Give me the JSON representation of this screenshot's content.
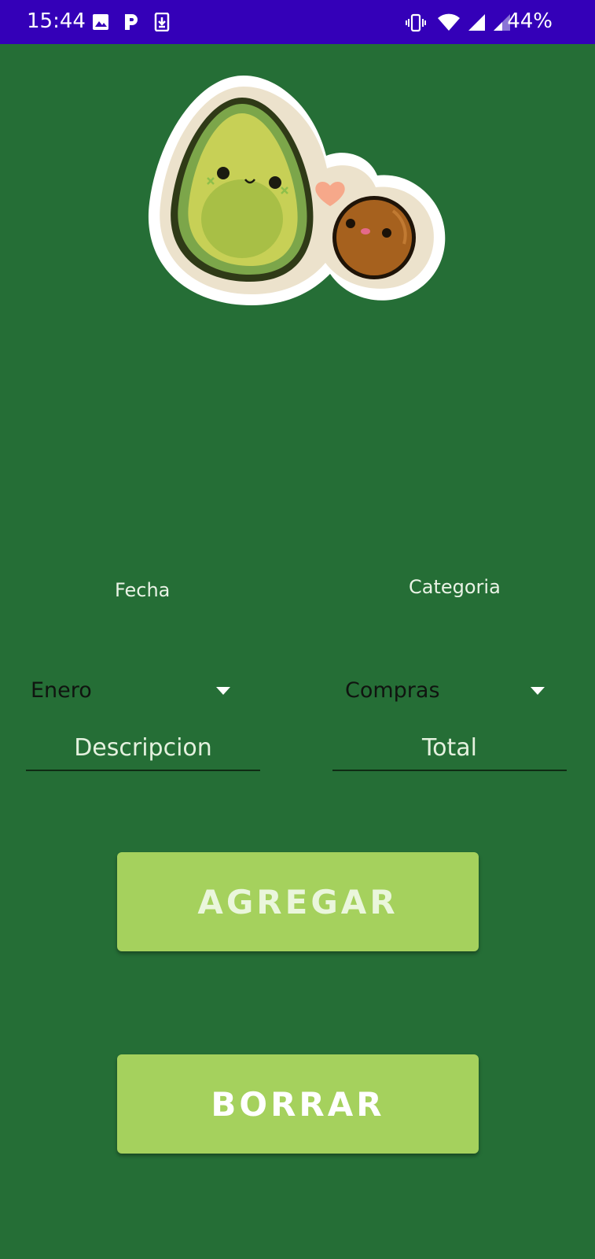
{
  "status_bar": {
    "time": "15:44",
    "battery": "44%",
    "icons": [
      "image-icon",
      "parking-app-icon",
      "download-icon",
      "vibrate-icon",
      "wifi-icon",
      "signal-icon",
      "signal-icon",
      "battery-text"
    ]
  },
  "mascot": {
    "icon": "avocado-mascot-icon"
  },
  "form": {
    "fecha_label": "Fecha",
    "categoria_label": "Categoria",
    "month_value": "Enero",
    "category_value": "Compras",
    "descripcion_placeholder": "Descripcion",
    "total_placeholder": "Total"
  },
  "buttons": {
    "agregar": "AGREGAR",
    "borrar": "BORRAR"
  },
  "colors": {
    "status_bar": "#3400b8",
    "background": "#256e36",
    "button": "#a5d15d"
  }
}
